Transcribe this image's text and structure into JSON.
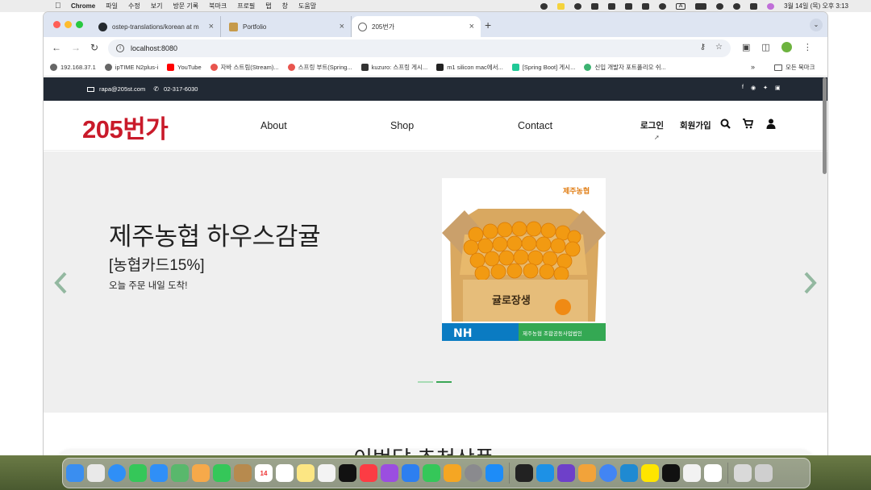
{
  "menubar": {
    "app_name": "Chrome",
    "menus": [
      "파일",
      "수정",
      "보기",
      "방문 기록",
      "북마크",
      "프로필",
      "탭",
      "창",
      "도움말"
    ],
    "clock": "3월 14일 (목) 오후 3:13",
    "input_source": "A"
  },
  "browser": {
    "tabs": [
      {
        "title": "ostep-translations/korean at m",
        "favicon": "github-icon",
        "active": false
      },
      {
        "title": "Portfolio",
        "favicon": "portfolio-icon",
        "active": false
      },
      {
        "title": "205번가",
        "favicon": "globe-icon",
        "active": true
      }
    ],
    "new_tab_label": "+",
    "url": "localhost:8080",
    "bookmarks": [
      {
        "label": "192.168.37.1",
        "icon": "globe-icon",
        "color": "#666666"
      },
      {
        "label": "ipTIME N2plus-i",
        "icon": "globe-icon",
        "color": "#666666"
      },
      {
        "label": "YouTube",
        "icon": "youtube-icon",
        "color": "#ff0000"
      },
      {
        "label": "자바 스트림(Stream)...",
        "icon": "site-icon",
        "color": "#e8554e"
      },
      {
        "label": "스프링 부트(Spring...",
        "icon": "site-icon",
        "color": "#e8554e"
      },
      {
        "label": "kuzuro: 스프링 게시...",
        "icon": "site-icon",
        "color": "#333333"
      },
      {
        "label": "m1 silicon mac에서...",
        "icon": "site-icon",
        "color": "#222222"
      },
      {
        "label": "[Spring Boot] 게시...",
        "icon": "velog-icon",
        "color": "#20c997"
      },
      {
        "label": "신입 개발자 포트폴리오 쉬...",
        "icon": "site-icon",
        "color": "#3cb371"
      }
    ],
    "bookmarks_more": "»",
    "all_bookmarks": "모든 북마크"
  },
  "site": {
    "topbar": {
      "email": "rapa@205st.com",
      "phone": "02-317-6030",
      "social_icons": [
        "facebook-icon",
        "instagram-icon",
        "twitter-icon",
        "linkedin-icon"
      ]
    },
    "logo": "205번가",
    "nav": {
      "about": "About",
      "shop": "Shop",
      "contact": "Contact",
      "login": "로그인",
      "signup": "회원가입"
    },
    "hero": {
      "title": "제주농협 하우스감귤",
      "subtitle": "[농협카드15%]",
      "description": "오늘 주문 내일 도착!",
      "slides": 2,
      "active_slide": 2,
      "image": {
        "brand_badge": "제주농협",
        "box_text": "귤로장생",
        "footer_logo": "NH",
        "footer_text": "제주농협 조합공동사업법인"
      }
    },
    "section_title": "이번달 추천상품"
  },
  "colors": {
    "logo": "#c91a2a",
    "topbar_bg": "#212934",
    "hero_bg": "#efefef",
    "carousel_arrow": "#93b8a0",
    "dot_active": "#3aa756",
    "dot_inactive": "#a8dbb5"
  }
}
